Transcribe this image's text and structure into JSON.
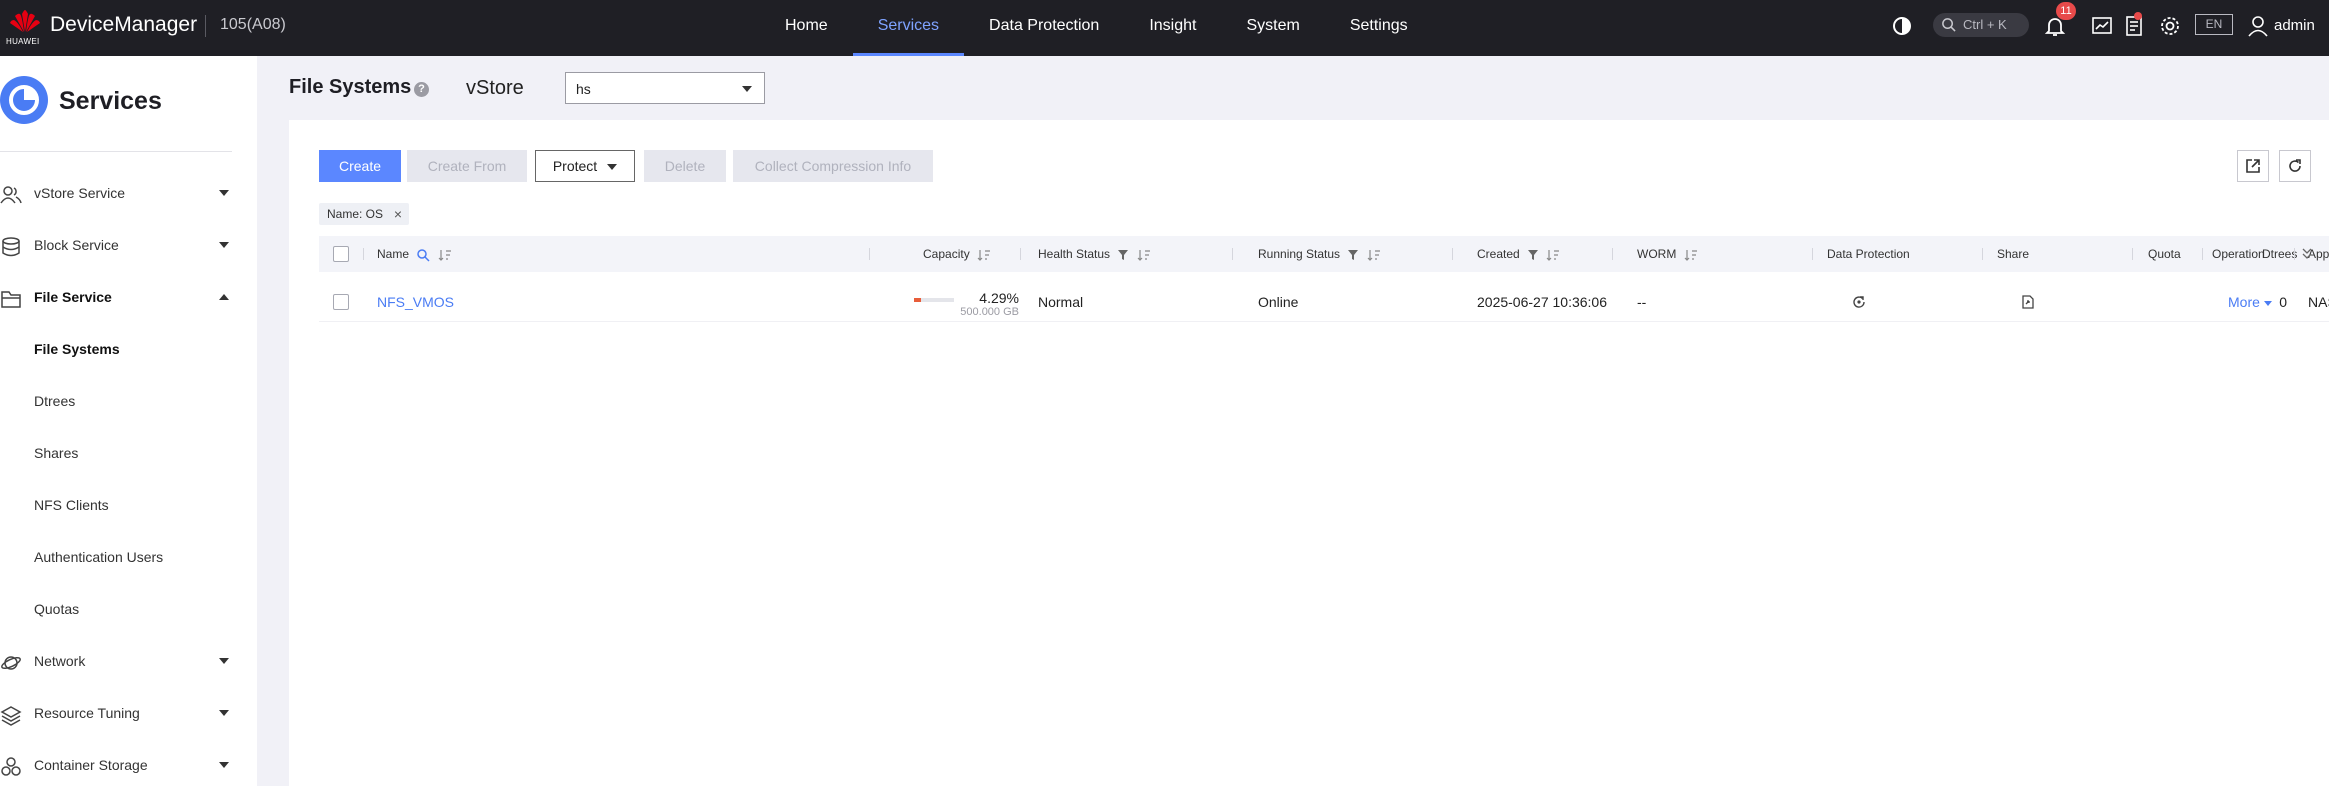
{
  "topbar": {
    "brand": "HUAWEI",
    "app_name": "DeviceManager",
    "device_id": "105(A08)",
    "nav": [
      {
        "label": "Home",
        "active": false
      },
      {
        "label": "Services",
        "active": true
      },
      {
        "label": "Data Protection",
        "active": false
      },
      {
        "label": "Insight",
        "active": false
      },
      {
        "label": "System",
        "active": false
      },
      {
        "label": "Settings",
        "active": false
      }
    ],
    "search_shortcut": "Ctrl + K",
    "notification_count": "11",
    "language": "EN",
    "user": "admin"
  },
  "sidebar": {
    "title": "Services",
    "items": [
      {
        "label": "vStore Service",
        "icon": "users-icon",
        "expanded": false
      },
      {
        "label": "Block Service",
        "icon": "database-icon",
        "expanded": false
      },
      {
        "label": "File Service",
        "icon": "folder-icon",
        "expanded": true
      }
    ],
    "sub_items": [
      {
        "label": "File Systems",
        "active": true
      },
      {
        "label": "Dtrees",
        "active": false
      },
      {
        "label": "Shares",
        "active": false
      },
      {
        "label": "NFS Clients",
        "active": false
      },
      {
        "label": "Authentication Users",
        "active": false
      },
      {
        "label": "Quotas",
        "active": false
      }
    ],
    "bottom_items": [
      {
        "label": "Network",
        "icon": "planet-icon"
      },
      {
        "label": "Resource Tuning",
        "icon": "layers-icon"
      },
      {
        "label": "Container Storage",
        "icon": "hexagons-icon"
      }
    ]
  },
  "main": {
    "title": "File Systems",
    "vstore_label": "vStore",
    "vstore_value": "hs",
    "buttons": {
      "create": "Create",
      "create_from": "Create From",
      "protect": "Protect",
      "delete": "Delete",
      "collect": "Collect Compression Info"
    },
    "filter_tag": "Name: OS",
    "columns": {
      "name": "Name",
      "capacity": "Capacity",
      "health": "Health Status",
      "running": "Running Status",
      "created": "Created",
      "worm": "WORM",
      "data_protection": "Data Protection",
      "share": "Share",
      "quota": "Quota",
      "dtrees": "Dtrees",
      "app_type": "Application Type",
      "operation": "Operation"
    },
    "rows": [
      {
        "name": "NFS_VMOS",
        "capacity_pct": "4.29%",
        "capacity_fraction": 0.0429,
        "capacity_total": "500.000 GB",
        "health": "Normal",
        "running": "Online",
        "created": "2025-06-27 10:36:06",
        "worm": "--",
        "dtrees": "0",
        "app_type": "NAS_Default",
        "operation": "More"
      }
    ]
  },
  "colors": {
    "accent": "#5b87ff",
    "topbar_bg": "#1f1f25",
    "capacity_fill": "#e85d3a",
    "badge": "#e84a4a"
  }
}
